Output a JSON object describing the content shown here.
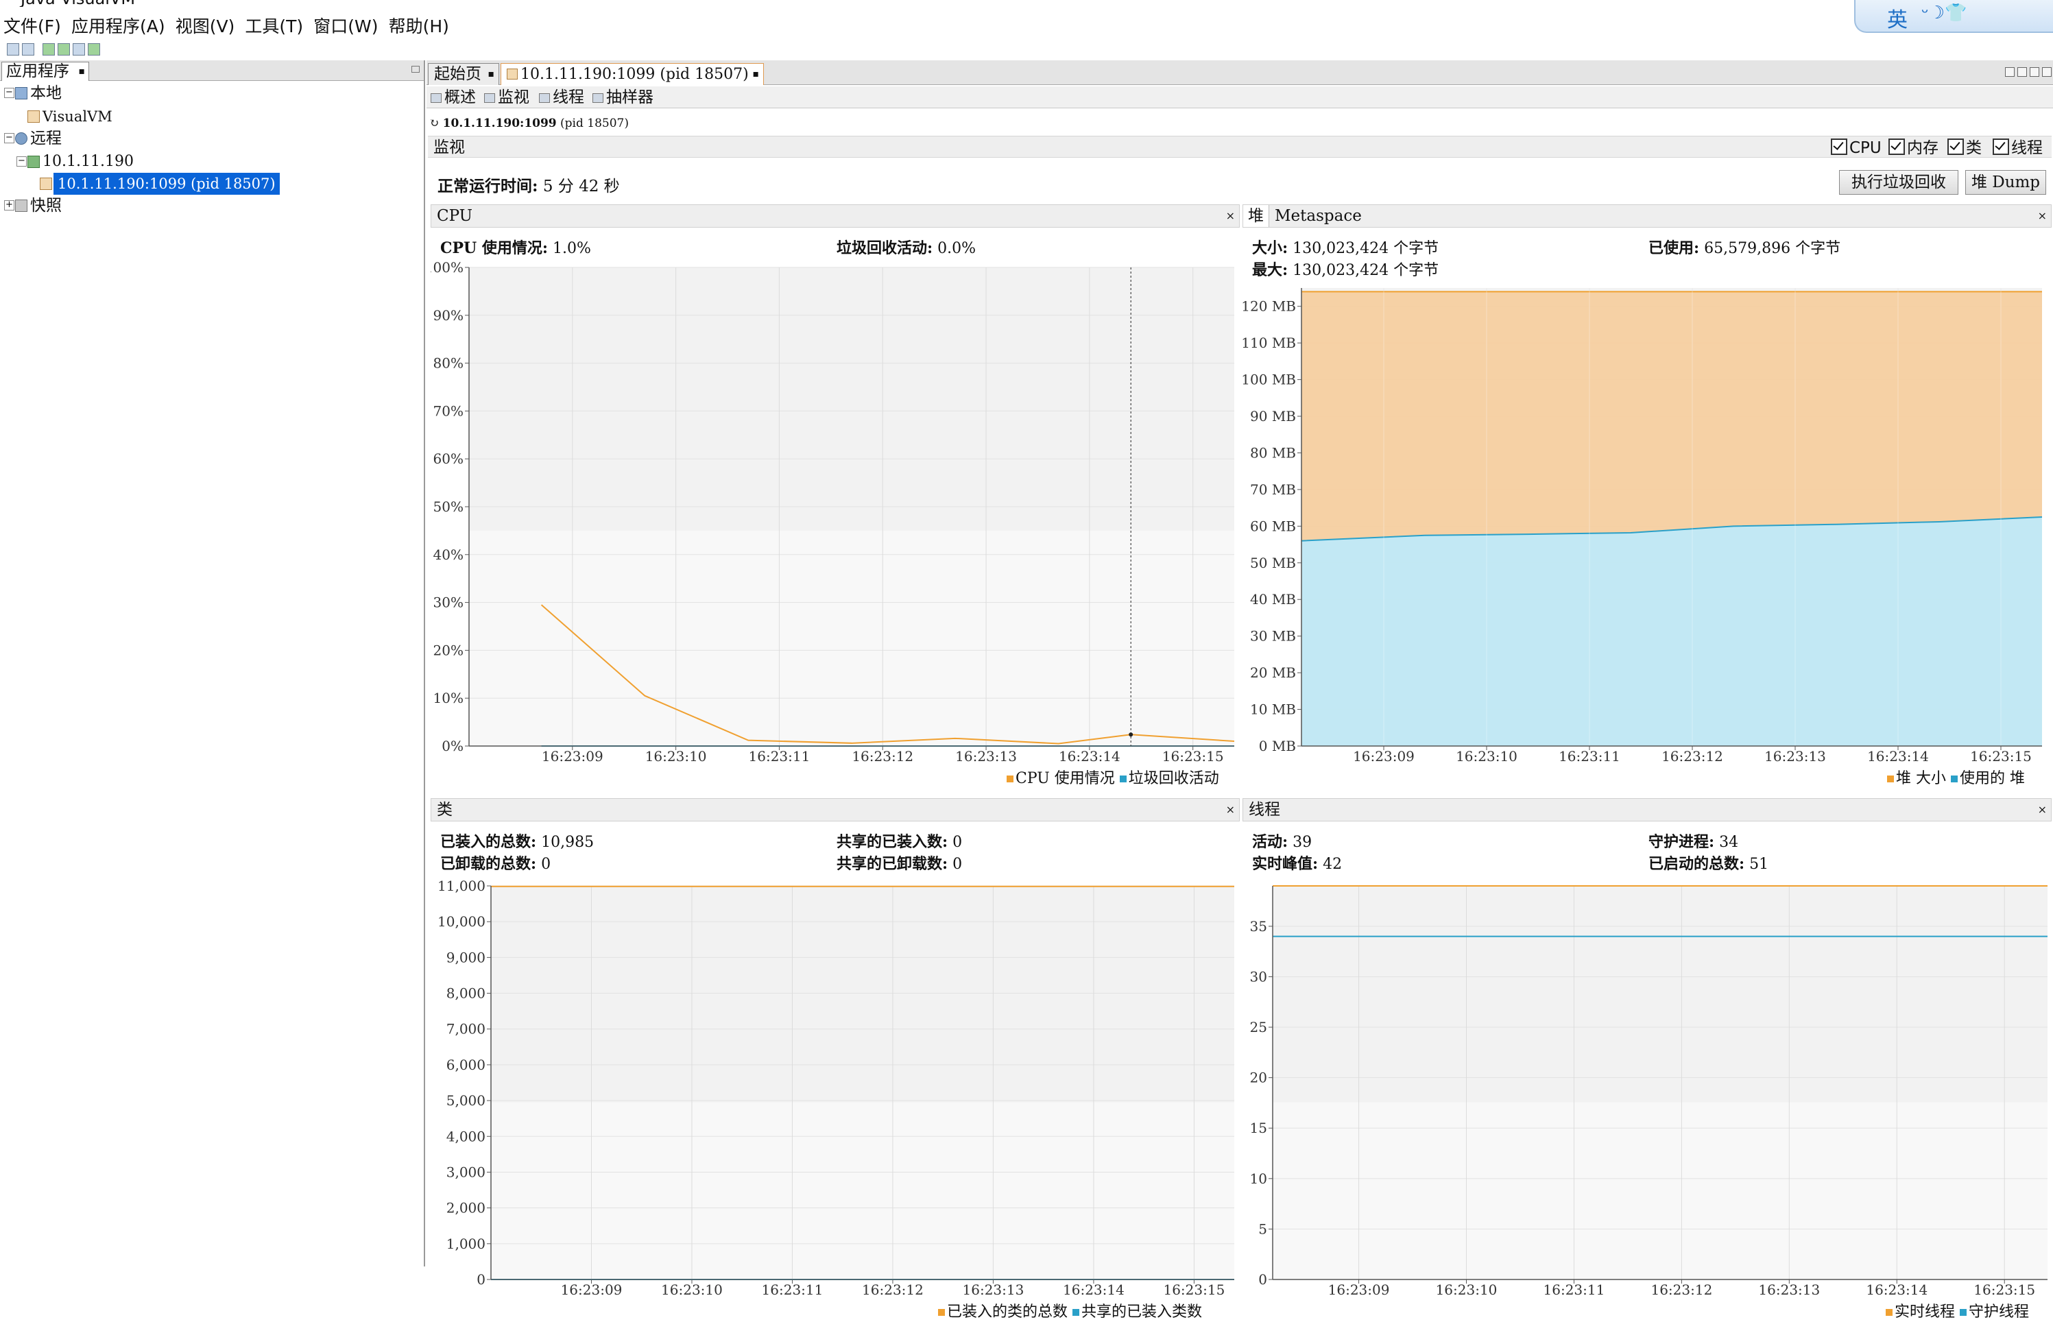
{
  "window": {
    "title": "Java VisualVM"
  },
  "menu": [
    "文件(F)",
    "应用程序(A)",
    "视图(V)",
    "工具(T)",
    "窗口(W)",
    "帮助(H)"
  ],
  "ime": {
    "label": "英",
    "glyphs": "ᵕ☽👕"
  },
  "left": {
    "tab": "应用程序",
    "tree": {
      "local": "本地",
      "visualvm": "VisualVM",
      "remote": "远程",
      "host": "10.1.11.190",
      "process": "10.1.11.190:1099 (pid 18507)",
      "snapshots": "快照"
    }
  },
  "right": {
    "tabs": [
      "起始页",
      "10.1.11.190:1099 (pid 18507)"
    ],
    "subtabs": [
      "概述",
      "监视",
      "线程",
      "抽样器"
    ],
    "process_line_bold": "10.1.11.190:1099",
    "process_line_pid": "(pid 18507)",
    "monitor_title": "监视",
    "checks": [
      "CPU",
      "内存",
      "类",
      "线程"
    ],
    "uptime_label": "正常运行时间:",
    "uptime_value": "5 分 42 秒",
    "buttons": {
      "gc": "执行垃圾回收",
      "heapdump": "堆 Dump"
    }
  },
  "cpu_panel": {
    "title": "CPU",
    "usage_label": "CPU 使用情况:",
    "usage_value": "1.0%",
    "gc_label": "垃圾回收活动:",
    "gc_value": "0.0%",
    "legend": [
      "CPU 使用情况",
      "垃圾回收活动"
    ]
  },
  "heap_panel": {
    "tabs": [
      "堆",
      "Metaspace"
    ],
    "size_label": "大小:",
    "size_value": "130,023,424 个字节",
    "max_label": "最大:",
    "max_value": "130,023,424 个字节",
    "used_label": "已使用:",
    "used_value": "65,579,896 个字节",
    "legend": [
      "堆 大小",
      "使用的 堆"
    ]
  },
  "class_panel": {
    "title": "类",
    "loaded_label": "已装入的总数:",
    "loaded_value": "10,985",
    "unloaded_label": "已卸载的总数:",
    "unloaded_value": "0",
    "shared_loaded_label": "共享的已装入数:",
    "shared_loaded_value": "0",
    "shared_unloaded_label": "共享的已卸载数:",
    "shared_unloaded_value": "0",
    "legend": [
      "已装入的类的总数",
      "共享的已装入类数"
    ]
  },
  "thread_panel": {
    "title": "线程",
    "live_label": "活动:",
    "live_value": "39",
    "daemon_label": "守护进程:",
    "daemon_value": "34",
    "peak_label": "实时峰值:",
    "peak_value": "42",
    "started_label": "已启动的总数:",
    "started_value": "51",
    "legend": [
      "实时线程",
      "守护线程"
    ]
  },
  "colors": {
    "orange": "#f0a030",
    "blue": "#2aa0c8",
    "heap_fill": "#f5cfa0",
    "used_fill": "#bfe9f8",
    "selection": "#0a64d8"
  },
  "chart_data": [
    {
      "type": "line",
      "name": "cpu",
      "categories": [
        "16:23:09",
        "16:23:10",
        "16:23:11",
        "16:23:12",
        "16:23:13",
        "16:23:14",
        "16:23:15"
      ],
      "ylim": [
        0,
        100
      ],
      "yticks": [
        "0%",
        "10%",
        "20%",
        "30%",
        "40%",
        "50%",
        "60%",
        "70%",
        "80%",
        "90%",
        "100%"
      ],
      "series": [
        {
          "name": "CPU 使用情况",
          "t": [
            8.7,
            9.7,
            10.7,
            11.7,
            12.7,
            13.7,
            14.4,
            15.4
          ],
          "values": [
            29.5,
            10.5,
            1.2,
            0.6,
            1.6,
            0.5,
            2.4,
            1.0
          ]
        },
        {
          "name": "垃圾回收活动",
          "t": [
            8.7,
            15.4
          ],
          "values": [
            0,
            0
          ]
        }
      ]
    },
    {
      "type": "area",
      "name": "heap",
      "categories": [
        "16:23:09",
        "16:23:10",
        "16:23:11",
        "16:23:12",
        "16:23:13",
        "16:23:14",
        "16:23:15"
      ],
      "ylim": [
        0,
        125
      ],
      "yticks": [
        "0 MB",
        "10 MB",
        "20 MB",
        "30 MB",
        "40 MB",
        "50 MB",
        "60 MB",
        "70 MB",
        "80 MB",
        "90 MB",
        "100 MB",
        "110 MB",
        "120 MB"
      ],
      "series": [
        {
          "name": "堆 大小",
          "t": [
            8.0,
            15.4
          ],
          "values": [
            124,
            124
          ]
        },
        {
          "name": "使用的 堆",
          "t": [
            8.0,
            8.2,
            9.4,
            10.4,
            11.4,
            12.4,
            13.4,
            14.4,
            15.4
          ],
          "values": [
            56,
            56,
            57.5,
            57.8,
            58.2,
            60,
            60.5,
            61.2,
            62.5
          ]
        }
      ]
    },
    {
      "type": "line",
      "name": "classes",
      "categories": [
        "16:23:09",
        "16:23:10",
        "16:23:11",
        "16:23:12",
        "16:23:13",
        "16:23:14",
        "16:23:15"
      ],
      "ylim": [
        0,
        11000
      ],
      "yticks": [
        "0",
        "1,000",
        "2,000",
        "3,000",
        "4,000",
        "5,000",
        "6,000",
        "7,000",
        "8,000",
        "9,000",
        "10,000",
        "11,000"
      ],
      "series": [
        {
          "name": "已装入的类的总数",
          "t": [
            8.0,
            15.4
          ],
          "values": [
            10985,
            10985
          ]
        },
        {
          "name": "共享的已装入类数",
          "t": [
            8.0,
            15.4
          ],
          "values": [
            0,
            0
          ]
        }
      ]
    },
    {
      "type": "line",
      "name": "threads",
      "categories": [
        "16:23:09",
        "16:23:10",
        "16:23:11",
        "16:23:12",
        "16:23:13",
        "16:23:14",
        "16:23:15"
      ],
      "ylim": [
        0,
        39
      ],
      "yticks": [
        "0",
        "5",
        "10",
        "15",
        "20",
        "25",
        "30",
        "35"
      ],
      "series": [
        {
          "name": "实时线程",
          "t": [
            8.0,
            15.4
          ],
          "values": [
            39,
            39
          ]
        },
        {
          "name": "守护线程",
          "t": [
            8.0,
            15.4
          ],
          "values": [
            34,
            34
          ]
        }
      ]
    }
  ]
}
